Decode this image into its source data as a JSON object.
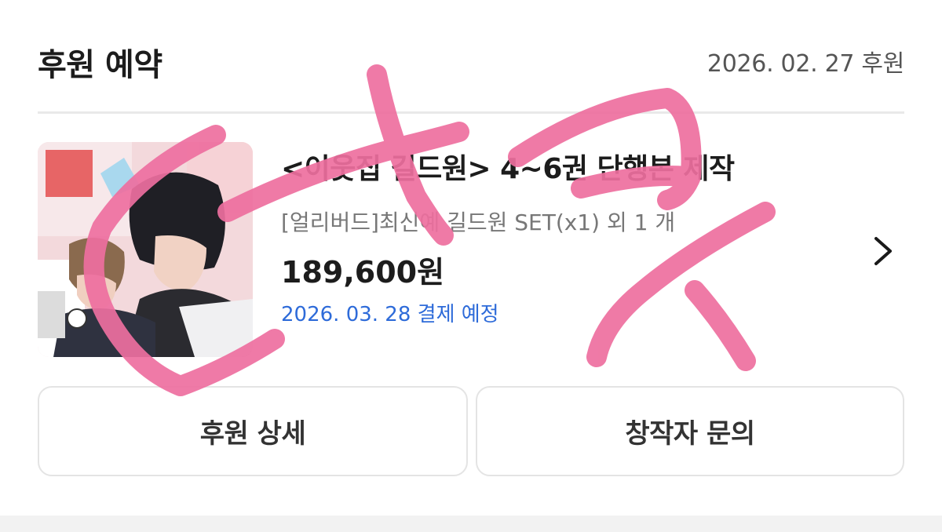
{
  "header": {
    "title": "후원 예약",
    "date": "2026. 02. 27 후원"
  },
  "project": {
    "title": "<이웃집 길드원> 4~6권 단행본 제작",
    "reward": "[얼리버드]최신예 길드원 SET(x1) 외 1 개",
    "amount": "189,600원",
    "schedule": "2026. 03. 28 결제 예정"
  },
  "buttons": {
    "detail": "후원 상세",
    "inquiry": "창작자 문의"
  },
  "icons": {
    "chevron": "chevron-right-icon"
  },
  "colors": {
    "accent_blue": "#2e6bd9",
    "scribble_pink": "#ee6f9f",
    "border": "#e4e4e4"
  }
}
